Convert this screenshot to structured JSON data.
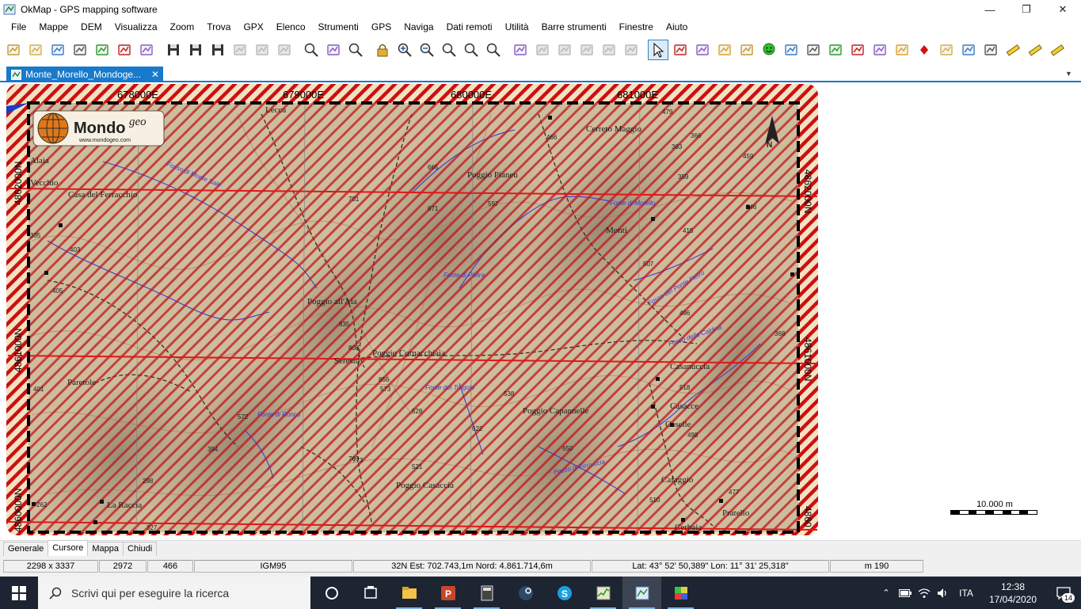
{
  "window": {
    "title": "OkMap - GPS mapping software",
    "minimize_glyph": "—",
    "maximize_glyph": "❐",
    "close_glyph": "✕"
  },
  "menu": [
    "File",
    "Mappe",
    "DEM",
    "Visualizza",
    "Zoom",
    "Trova",
    "GPX",
    "Elenco",
    "Strumenti",
    "GPS",
    "Naviga",
    "Dati remoti",
    "Utilità",
    "Barre strumenti",
    "Finestre",
    "Aiuto"
  ],
  "toolbar": {
    "icons": [
      "open-map-icon",
      "open-map-folder-icon",
      "map-list-icon",
      "map-calibrate-icon",
      "map-georef-icon",
      "map-export-icon",
      "map-properties-icon",
      "save-icon",
      "save-as-icon",
      "save-selected-icon",
      "gpx-disabled-icon",
      "print-disabled-icon",
      "print-preview-disabled-icon",
      "search-location-icon",
      "map-view-icon",
      "zoom-fit-icon",
      "lock-icon",
      "zoom-in-icon",
      "zoom-out-icon",
      "zoom-window-icon",
      "zoom-previous-icon",
      "zoom-1-1-icon",
      "edit-track-icon",
      "disabled-tool-1-icon",
      "disabled-tool-2-icon",
      "disabled-tool-3-icon",
      "disabled-tool-4-icon",
      "disabled-tool-5-icon",
      "select-pointer-icon",
      "select-add-icon",
      "select-region-icon",
      "eraser-icon",
      "move-icon",
      "smiley-waypoint-icon",
      "comment-icon",
      "route-dots-icon",
      "route-curve-icon",
      "polygon-icon",
      "area-icon",
      "track-edit-icon",
      "waypoint-diamond-icon",
      "waypoint-arrow-icon",
      "waypoint-move-icon",
      "waypoint-delete-icon",
      "ruler-icon",
      "ruler-edit-icon",
      "ruler-delete-icon"
    ],
    "selected_index": 28
  },
  "document_tab": {
    "label": "Monte_Morello_Mondoge...",
    "close": "✕"
  },
  "map": {
    "grid_easting_labels": [
      "678000E",
      "679000E",
      "680000E",
      "681000E"
    ],
    "grid_northing_left": [
      "4862000N",
      "4861000N",
      "4860000N"
    ],
    "grid_northing_right": [
      "4862000N",
      "4861000N",
      "4860"
    ],
    "logo_text": "Mondo",
    "logo_superscript": "geo",
    "logo_url": "www.mondogeo.com",
    "place_labels": [
      "Poggio Pianeu",
      "Poggio all'Aia",
      "Poggio Cornacchiaia",
      "Poggio Capannelle",
      "Poggio Casaccia",
      "Cerreto Maggio",
      "Monti",
      "Vecchio",
      "Casa del Ferracchio",
      "Paretole",
      "La Raccia",
      "Lecca",
      "Seresto",
      "Casanuccia",
      "Caselle",
      "Cafaggio",
      "Pratello",
      "Casacce",
      "Cerbaia",
      "Alaia"
    ],
    "water_labels": [
      "Fosso di Monte Sale",
      "Fonte di Pietra",
      "Fonte di Ronco",
      "Fosso del Ponte Pietro",
      "Fonte del Trogolo",
      "Fosso di Ferruccia",
      "Fosso della Caldina",
      "Fonte di Morello"
    ],
    "spot_heights": [
      "466",
      "363",
      "359",
      "346",
      "368",
      "507",
      "496",
      "518",
      "498",
      "650",
      "773",
      "671",
      "597",
      "808",
      "835",
      "665",
      "479",
      "459",
      "366",
      "415",
      "701",
      "394",
      "572",
      "573",
      "856",
      "538",
      "622",
      "763",
      "521",
      "528",
      "510",
      "477",
      "401",
      "262",
      "327",
      "298",
      "335",
      "403",
      "405"
    ],
    "colors": {
      "hatch_red": "#cc1010",
      "hatch_cream": "#f2e2c4",
      "terrain_base": "#c9b79a",
      "grid_red": "#e01818",
      "water_blue": "#3a3ad0",
      "frame_black": "#000000"
    }
  },
  "scale": {
    "label": "10.000 m"
  },
  "bottom_tabs": [
    "Generale",
    "Cursore",
    "Mappa",
    "Chiudi"
  ],
  "bottom_tab_active": "Cursore",
  "status": {
    "image_size": "2298 x 3337",
    "pixel_x": "2972",
    "pixel_y": "466",
    "datum": "IGM95",
    "utm": "32N  Est: 702.743,1m  Nord: 4.861.714,6m",
    "latlon": "Lat: 43° 52' 50,389\"  Lon: 11° 31' 25,318\"",
    "elevation": "m 190"
  },
  "taskbar": {
    "search_placeholder": "Scrivi qui per eseguire la ricerca",
    "apps": [
      "cortana-circle-icon",
      "task-view-icon",
      "file-explorer-icon",
      "powerpoint-icon",
      "calculator-icon",
      "steam-icon",
      "skype-icon",
      "task-manager-icon",
      "okmap-icon",
      "color-app-icon"
    ],
    "language": "ITA",
    "time": "12:38",
    "date": "17/04/2020",
    "notifications": "14"
  }
}
